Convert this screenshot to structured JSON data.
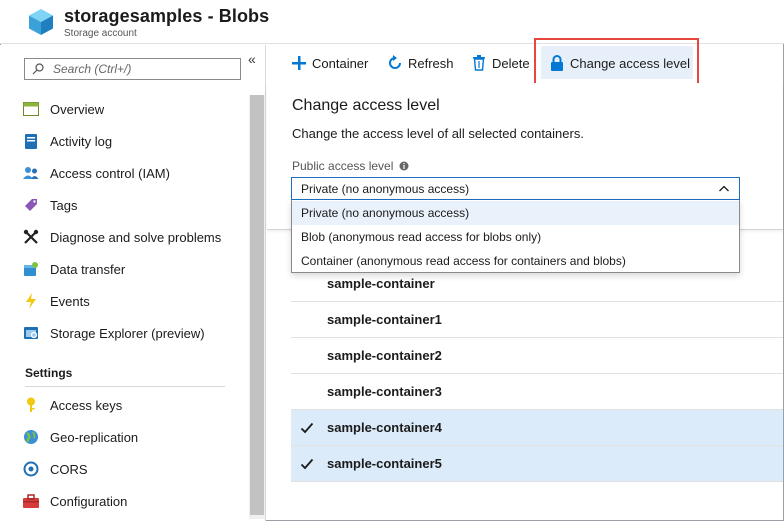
{
  "header": {
    "title": "storagesamples - Blobs",
    "subtitle": "Storage account"
  },
  "sidebar": {
    "search_placeholder": "Search (Ctrl+/)",
    "collapse_glyph": "«",
    "items": [
      {
        "label": "Overview",
        "icon": "overview-icon"
      },
      {
        "label": "Activity log",
        "icon": "activity-log-icon"
      },
      {
        "label": "Access control (IAM)",
        "icon": "iam-icon"
      },
      {
        "label": "Tags",
        "icon": "tag-icon"
      },
      {
        "label": "Diagnose and solve problems",
        "icon": "wrench-icon"
      },
      {
        "label": "Data transfer",
        "icon": "data-transfer-icon"
      },
      {
        "label": "Events",
        "icon": "lightning-icon"
      },
      {
        "label": "Storage Explorer (preview)",
        "icon": "storage-explorer-icon"
      }
    ],
    "settings_heading": "Settings",
    "settings_items": [
      {
        "label": "Access keys",
        "icon": "key-icon"
      },
      {
        "label": "Geo-replication",
        "icon": "globe-icon"
      },
      {
        "label": "CORS",
        "icon": "cors-icon"
      },
      {
        "label": "Configuration",
        "icon": "toolbox-icon"
      }
    ]
  },
  "toolbar": {
    "container_label": "Container",
    "refresh_label": "Refresh",
    "delete_label": "Delete",
    "change_access_label": "Change access level"
  },
  "panel": {
    "title": "Change access level",
    "description": "Change the access level of all selected containers.",
    "field_label": "Public access level",
    "selected_value": "Private (no anonymous access)",
    "options": [
      "Private (no anonymous access)",
      "Blob (anonymous read access for blobs only)",
      "Container (anonymous read access for containers and blobs)"
    ]
  },
  "containers": [
    {
      "name": "sample-container",
      "checked": false
    },
    {
      "name": "sample-container1",
      "checked": false
    },
    {
      "name": "sample-container2",
      "checked": false
    },
    {
      "name": "sample-container3",
      "checked": false
    },
    {
      "name": "sample-container4",
      "checked": true
    },
    {
      "name": "sample-container5",
      "checked": true
    }
  ],
  "colors": {
    "accent": "#0078d4",
    "highlight_border": "#e8473f",
    "selected_row": "#dbebf9"
  }
}
